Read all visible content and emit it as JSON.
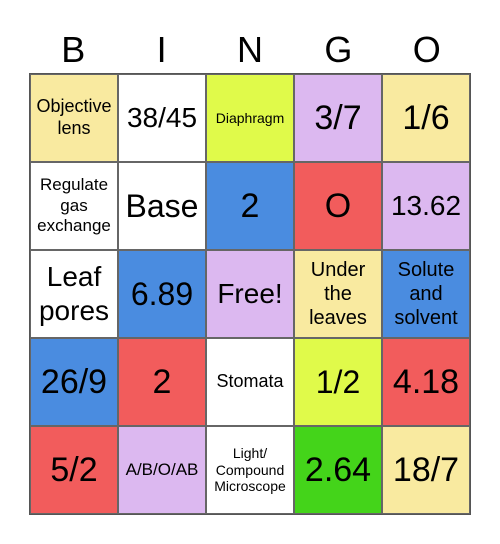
{
  "header": [
    "B",
    "I",
    "N",
    "G",
    "O"
  ],
  "colors": {
    "yellow": "#f9eaa0",
    "white": "#ffffff",
    "lime": "#e0fa4a",
    "lavender": "#dcb8f0",
    "red": "#f25c5c",
    "blue": "#4a8ce0",
    "green": "#44d41a"
  },
  "cells": [
    [
      "Objective lens",
      "38/45",
      "Diaphragm",
      "3/7",
      "1/6"
    ],
    [
      "Regulate gas exchange",
      "Base",
      "2",
      "O",
      "13.62"
    ],
    [
      "Leaf pores",
      "6.89",
      "Free!",
      "Under the leaves",
      "Solute and solvent"
    ],
    [
      "26/9",
      "2",
      "Stomata",
      "1/2",
      "4.18"
    ],
    [
      "5/2",
      "A/B/O/AB",
      "Light/ Compound Microscope",
      "2.64",
      "18/7"
    ]
  ]
}
